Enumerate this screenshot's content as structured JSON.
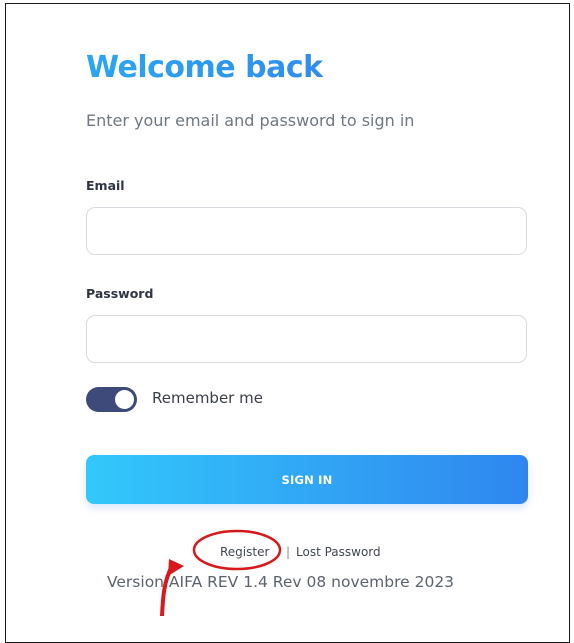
{
  "login": {
    "title": "Welcome back",
    "subtitle": "Enter your email and password to sign in",
    "email_label": "Email",
    "email_value": "",
    "password_label": "Password",
    "password_value": "",
    "remember_label": "Remember me",
    "remember_on": true,
    "signin_label": "SIGN IN",
    "register_label": "Register",
    "separator": "|",
    "lost_password_label": "Lost Password",
    "version_text": "Version AIFA REV 1.4 Rev 08 novembre 2023"
  },
  "colors": {
    "title": "#2aa6f2",
    "button_start": "#33c8fb",
    "button_end": "#2f86ef",
    "toggle": "#3e4a7a",
    "annotation": "#d7191c"
  },
  "annotations": {
    "circle_target": "register-link",
    "arrow": "red-curved-arrow"
  }
}
